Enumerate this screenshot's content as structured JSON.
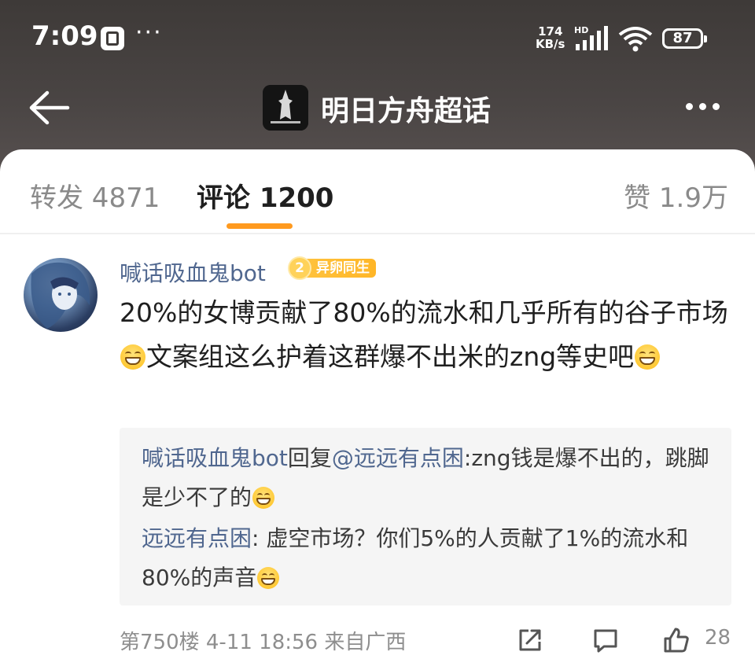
{
  "status_bar": {
    "time": "7:09",
    "net_speed_value": "174",
    "net_speed_unit": "KB/s",
    "network_type": "HD",
    "battery": "87"
  },
  "nav": {
    "title": "明日方舟超话"
  },
  "tabs": {
    "forward": "转发 4871",
    "comments": "评论 1200",
    "likes": "赞 1.9万"
  },
  "comment": {
    "username": "喊话吸血鬼bot",
    "badge_level": "2",
    "badge_text": "异卵同生",
    "text_part1": "20%的女博贡献了80%的流水和几乎所有的谷子市场",
    "text_part2": "文案组这么护着这群爆不出米的zng等史吧",
    "meta": "第750楼  4-11 18:56  来自广西",
    "like_count": "28"
  },
  "replies": [
    {
      "author": "喊话吸血鬼bot",
      "reply_word": "回复",
      "mention": "@远远有点困",
      "text": ":zng钱是爆不出的，跳脚是少不了的"
    },
    {
      "author": "远远有点困",
      "text": ": 虚空市场？你们5%的人贡献了1%的流水和80%的声音"
    }
  ],
  "icons": {
    "back": "back-arrow-icon",
    "more": "more-dots-icon",
    "share": "share-icon",
    "comment": "comment-icon",
    "like": "thumbs-up-icon",
    "emoji": "grin-emoji-icon"
  },
  "colors": {
    "accent": "#ff9a1f",
    "link": "#50678f",
    "header_bg": "#3e3a38"
  }
}
